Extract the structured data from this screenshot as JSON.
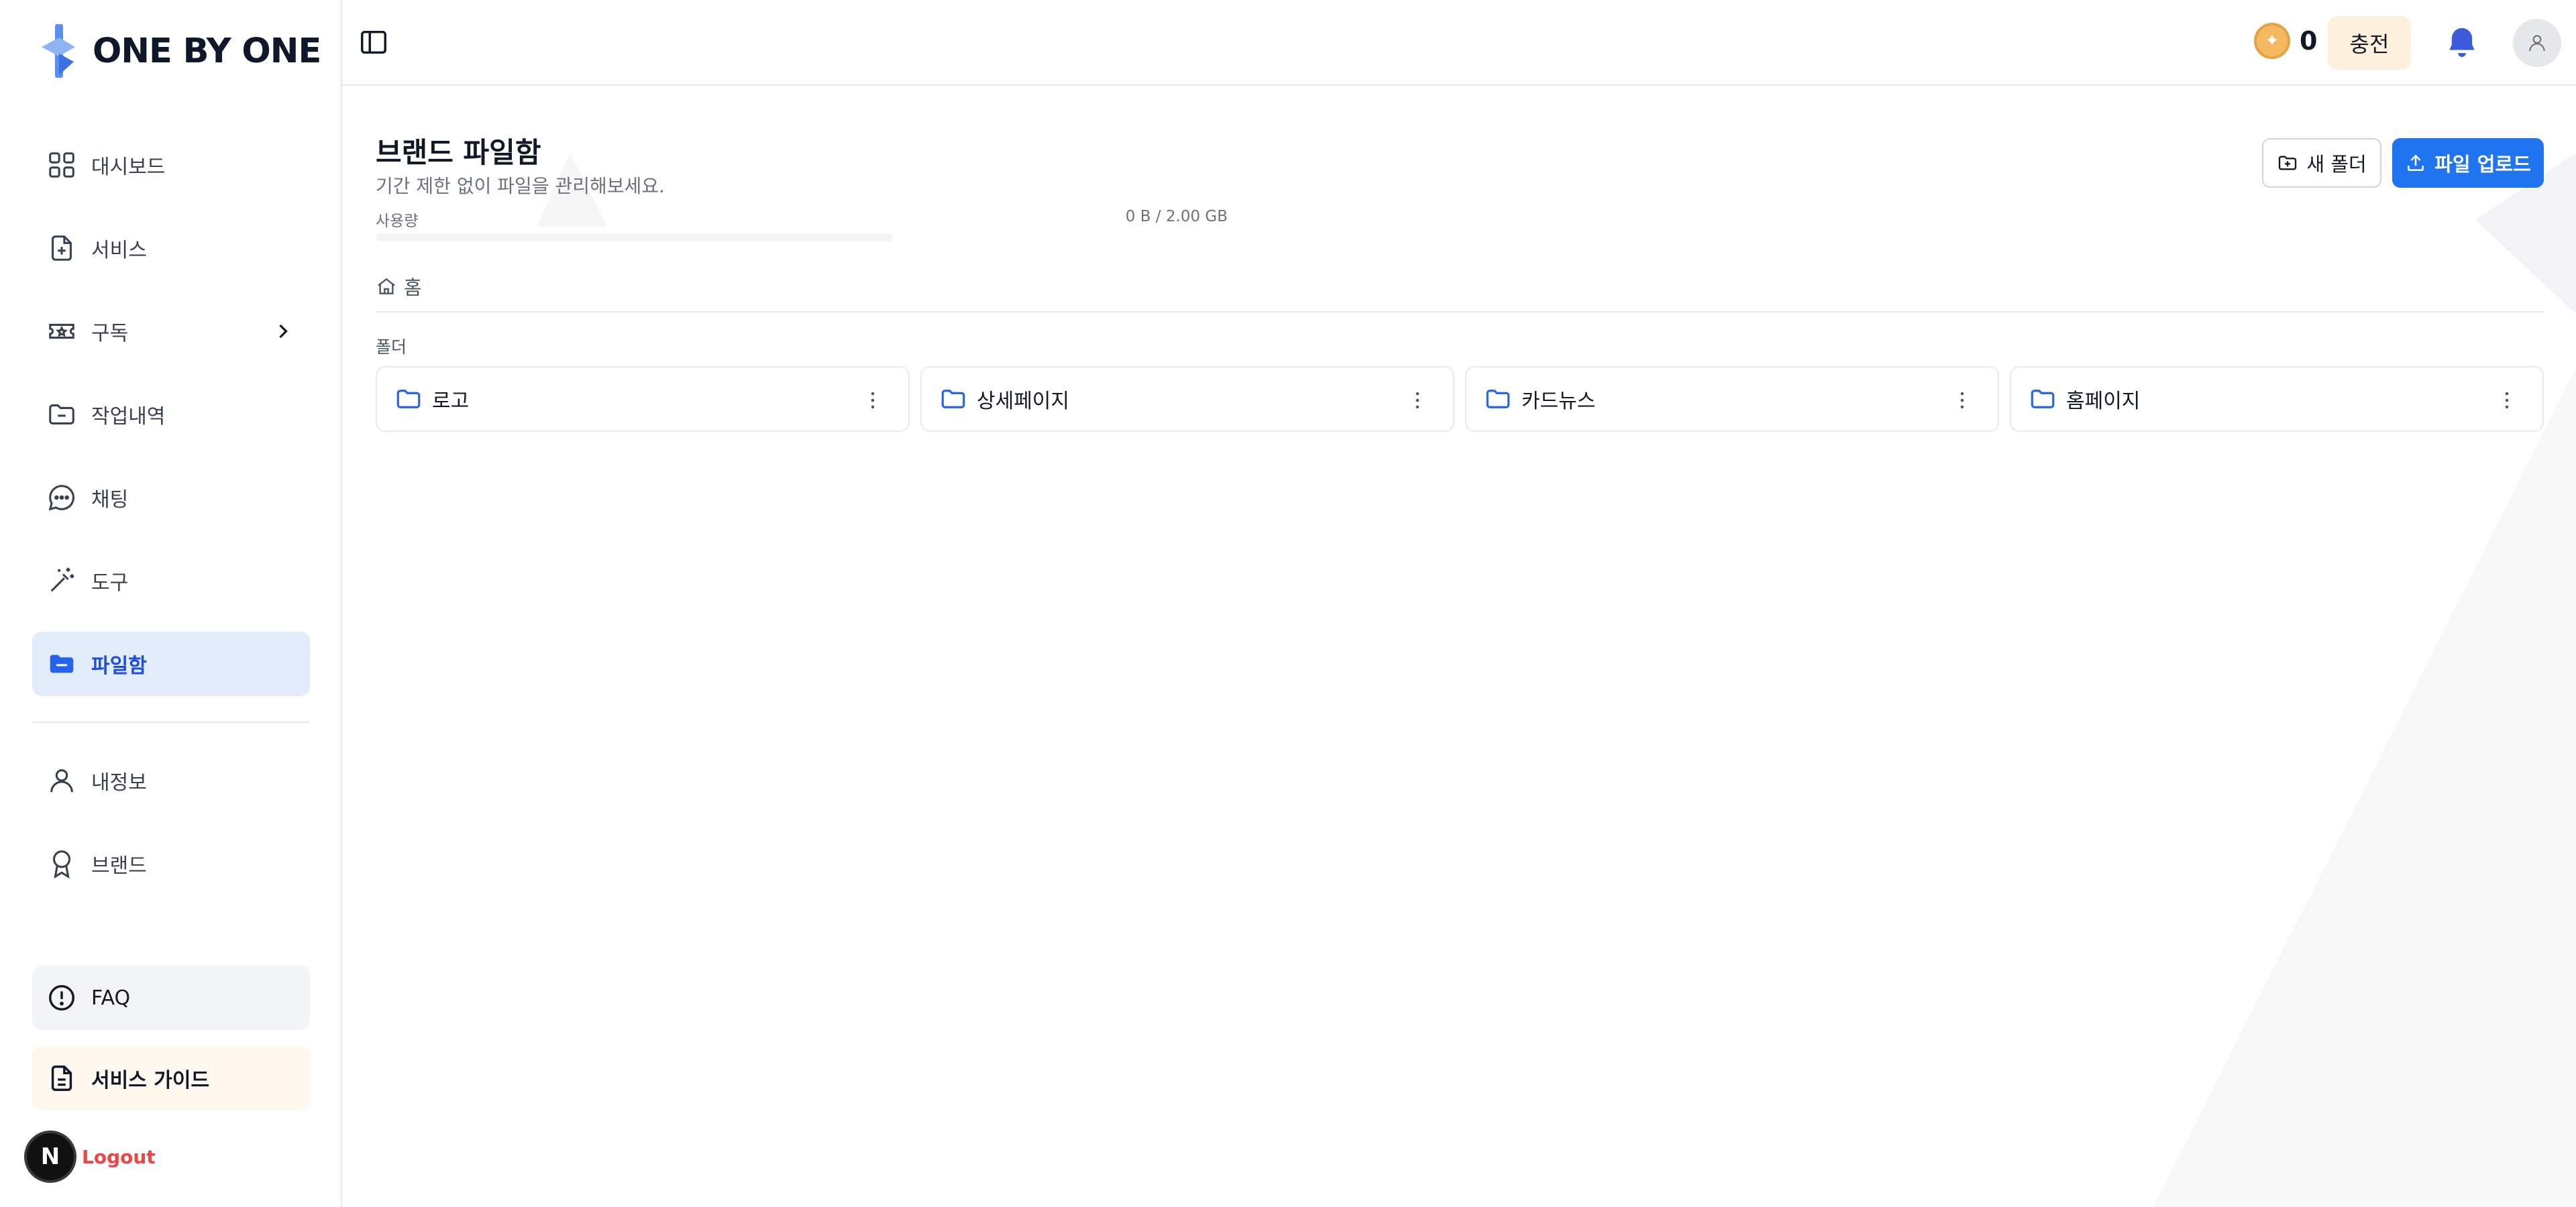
{
  "brand": {
    "name": "ONE BY ONE"
  },
  "sidebar": {
    "items": [
      {
        "label": "대시보드",
        "icon": "grid-icon"
      },
      {
        "label": "서비스",
        "icon": "file-plus-icon"
      },
      {
        "label": "구독",
        "icon": "ticket-icon"
      },
      {
        "label": "작업내역",
        "icon": "folder-minus-icon"
      },
      {
        "label": "채팅",
        "icon": "chat-bubble-icon"
      },
      {
        "label": "도구",
        "icon": "magic-wand-icon"
      },
      {
        "label": "파일함",
        "icon": "folder-icon",
        "active": true
      },
      {
        "label": "내정보",
        "icon": "user-icon"
      },
      {
        "label": "브랜드",
        "icon": "award-icon"
      }
    ],
    "faq_label": "FAQ",
    "guide_label": "서비스 가이드",
    "logout_label": "Logout",
    "avatar_letter": "N"
  },
  "header": {
    "coin_count": "0",
    "charge_label": "충전"
  },
  "main": {
    "title": "브랜드 파일함",
    "subtitle": "기간 제한 없이 파일을 관리해보세요.",
    "usage_label": "사용량",
    "usage_value": "0 B / 2.00 GB",
    "usage_fraction": 0,
    "new_folder_label": "새 폴더",
    "upload_label": "파일 업로드",
    "breadcrumb_home": "홈",
    "folders_section_label": "폴더",
    "folders": [
      {
        "name": "로고"
      },
      {
        "name": "상세페이지"
      },
      {
        "name": "카드뉴스"
      },
      {
        "name": "홈페이지"
      }
    ]
  },
  "colors": {
    "accent": "#1f74ef",
    "active_bg": "#e3ecfb",
    "logout": "#ef4444",
    "coin": "#f4b860"
  }
}
